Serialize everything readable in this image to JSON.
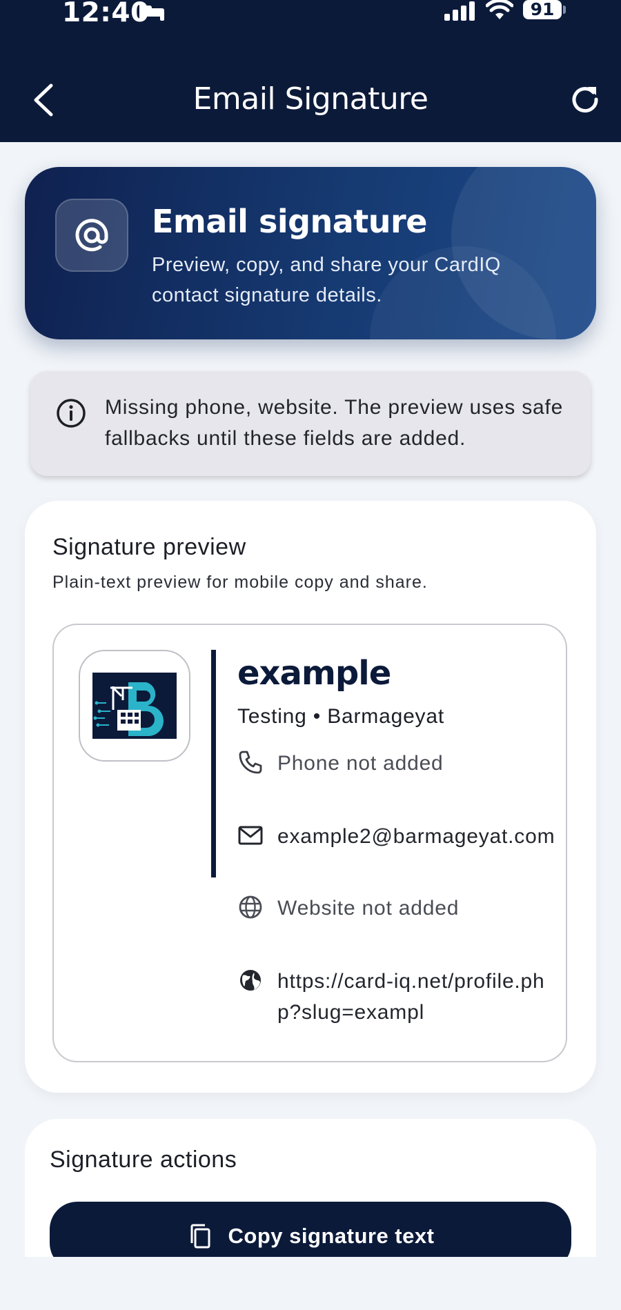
{
  "status_bar": {
    "time": "12:40",
    "battery": "91"
  },
  "header": {
    "title": "Email Signature"
  },
  "hero": {
    "title": "Email signature",
    "subtitle": "Preview, copy, and share your CardIQ contact signature details."
  },
  "notice": {
    "text": "Missing phone, website. The preview uses safe fallbacks until these fields are added."
  },
  "preview": {
    "title": "Signature preview",
    "subtitle": "Plain-text preview for mobile copy and share.",
    "name": "example",
    "role": "Testing • Barmageyat",
    "phone": "Phone not added",
    "email": "example2@barmageyat.com",
    "website": "Website not added",
    "profile_url": "https://card-iq.net/profile.php?slug=exampl"
  },
  "actions": {
    "title": "Signature actions",
    "copy_label": "Copy signature text"
  },
  "colors": {
    "navy": "#0c1a3a",
    "background": "#f1f4f8",
    "accent_teal": "#2ab3c9"
  }
}
